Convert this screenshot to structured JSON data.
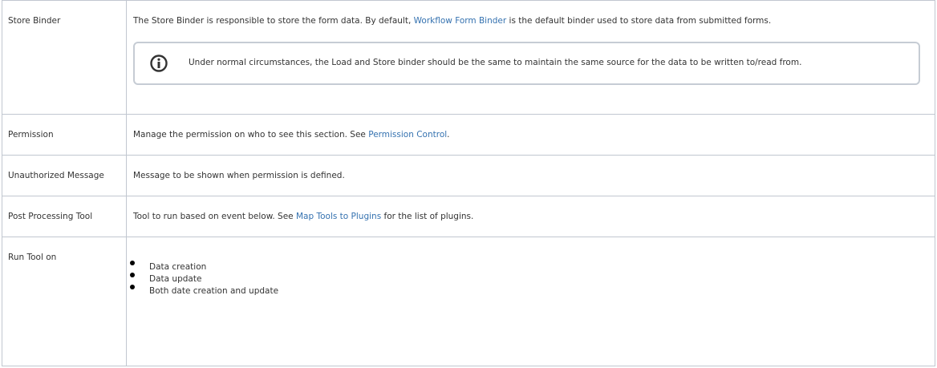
{
  "rows": {
    "store_binder": {
      "label": "Store Binder",
      "text_before": "The Store Binder is responsible to store the form data. By default, ",
      "link": "Workflow Form Binder",
      "text_after": " is the default binder used to store data from submitted forms.",
      "note": "Under normal circumstances, the Load and Store binder should be the same to maintain the same source for the data to be written to/read from.",
      "note_icon": "info-icon"
    },
    "permission": {
      "label": "Permission",
      "text_before": "Manage the permission on who to see this section. See ",
      "link": "Permission Control",
      "text_after": "."
    },
    "unauthorized_message": {
      "label": "Unauthorized Message",
      "text": "Message to be shown when permission is defined."
    },
    "post_processing_tool": {
      "label": "Post Processing Tool",
      "text_before": "Tool to run based on event below. See ",
      "link": "Map Tools to Plugins",
      "text_after": " for the list of plugins."
    },
    "run_tool_on": {
      "label": "Run Tool on",
      "items": [
        "Data creation",
        "Data update",
        "Both date creation and update"
      ]
    }
  },
  "colors": {
    "link": "#3572b0",
    "border": "#c1c7d0",
    "text": "#333333"
  }
}
